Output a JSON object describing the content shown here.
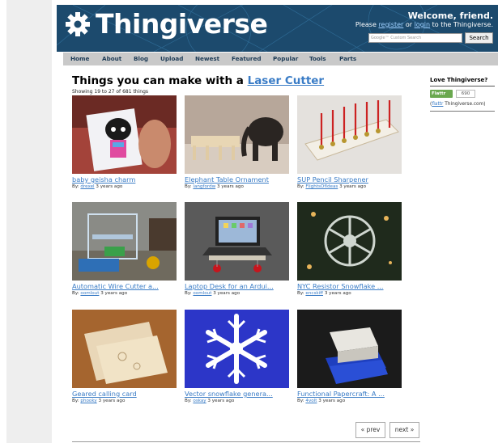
{
  "header": {
    "logo_text": "Thingiverse",
    "welcome": "Welcome, friend.",
    "login_prefix": "Please ",
    "register_label": "register",
    "or_text": " or ",
    "login_label": "login",
    "login_suffix": " to the Thingiverse.",
    "search_placeholder": "Google™ Custom Search",
    "search_button": "Search"
  },
  "nav": {
    "items": [
      {
        "label": "Home"
      },
      {
        "label": "About"
      },
      {
        "label": "Blog"
      },
      {
        "label": "Upload"
      },
      {
        "label": "Newest"
      },
      {
        "label": "Featured"
      },
      {
        "label": "Popular"
      },
      {
        "label": "Tools"
      },
      {
        "label": "Parts"
      }
    ]
  },
  "main": {
    "title_prefix": "Things you can make with a ",
    "title_link": "Laser Cutter",
    "showing": "Showing 19 to 27 of 681 things",
    "by_label": "By: ",
    "things": [
      {
        "title": "baby geisha charm",
        "author": "drexel",
        "age": "3 years ago",
        "icon": "geisha-charm-photo"
      },
      {
        "title": "Elephant Table Ornament",
        "author": "langfordw",
        "age": "3 years ago",
        "icon": "elephant-ornament-photo"
      },
      {
        "title": "SUP Pencil Sharpener",
        "author": "FlightsOfIdeas",
        "age": "3 years ago",
        "icon": "pencil-sharpener-photo"
      },
      {
        "title": "Automatic Wire Cutter a...",
        "author": "oomlout",
        "age": "3 years ago",
        "icon": "wire-cutter-photo"
      },
      {
        "title": "Laptop Desk for an Ardui...",
        "author": "oomlout",
        "age": "3 years ago",
        "icon": "laptop-desk-photo"
      },
      {
        "title": "NYC Resistor Snowflake ...",
        "author": "encskiff",
        "age": "3 years ago",
        "icon": "resistor-snowflake-photo"
      },
      {
        "title": "Geared calling card",
        "author": "phooky",
        "age": "3 years ago",
        "icon": "geared-card-photo"
      },
      {
        "title": "Vector snowflake genera...",
        "author": "oskay",
        "age": "3 years ago",
        "icon": "vector-snowflake-photo"
      },
      {
        "title": "Functional Papercraft: A ...",
        "author": "4volt",
        "age": "3 years ago",
        "icon": "papercraft-box-photo"
      }
    ]
  },
  "sidebar": {
    "love_title": "Love Thingiverse?",
    "flattr_button": "Flattr",
    "flattr_count": "690",
    "flattr_link_open": "(",
    "flattr_link_label": "flattr",
    "flattr_link_text": " Thingiverse.com)"
  },
  "pager": {
    "prev": "« prev",
    "next": "next »"
  },
  "colors": {
    "header_bg": "#1c4a6d",
    "link": "#3a7cc6",
    "nav_bg": "#c9c9c9"
  }
}
